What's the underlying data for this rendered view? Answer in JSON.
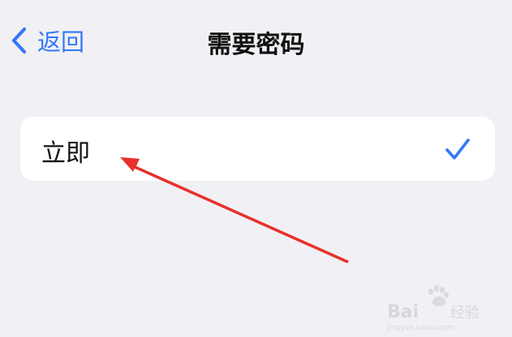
{
  "nav": {
    "back_label": "返回",
    "title": "需要密码"
  },
  "options": [
    {
      "label": "立即",
      "selected": true
    }
  ],
  "watermark": {
    "brand": "Baidu经验",
    "domain": "jingyan.baidu.com"
  },
  "colors": {
    "accent": "#3478f6",
    "background": "#f1f0f5",
    "annotation_arrow": "#e8312b"
  },
  "icons": {
    "back": "chevron-left-icon",
    "selected": "checkmark-icon"
  }
}
